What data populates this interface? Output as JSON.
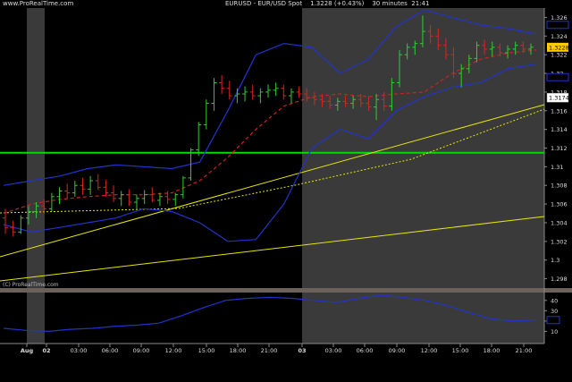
{
  "header": {
    "site": "www.ProRealTime.com",
    "instrument": "EURUSD - EUR/USD Spot",
    "price_change": "1.3228 (+0.43%)",
    "timeframe": "30 minutes",
    "clock": "21:41"
  },
  "watermark": "(C) ProRealTime.com",
  "colors": {
    "up_candle": "#33cc33",
    "down_candle": "#dd2222",
    "bollinger": "#2233cc",
    "moving_average": "#cc2222",
    "trendline": "#e6e600",
    "horizontal_line": "#00dd00",
    "today_background": "#3a3a3a",
    "price_marker": "#ffcc00"
  },
  "price_axis": {
    "ticks": [
      "1.326",
      "1.324",
      "1.322",
      "1.32",
      "1.318",
      "1.316",
      "1.314",
      "1.312",
      "1.31",
      "1.308",
      "1.306",
      "1.304",
      "1.302",
      "1.3",
      "1.298"
    ],
    "current_price_label": "1.3228",
    "trendline_label": "1.3174"
  },
  "indicator_axis": {
    "ticks": [
      "40",
      "30",
      "20",
      "10"
    ]
  },
  "time_axis": {
    "labels": [
      "Aug",
      "02",
      "03:00",
      "06:00",
      "09:00",
      "12:00",
      "15:00",
      "18:00",
      "21:00",
      "03",
      "03:00",
      "06:00",
      "09:00",
      "12:00",
      "15:00",
      "18:00",
      "21:00"
    ]
  },
  "chart_data": {
    "type": "candlestick",
    "symbol": "EURUSD",
    "timeframe": "30 minutes",
    "ylim": [
      1.297,
      1.327
    ],
    "candles": [
      [
        1.3045,
        1.3055,
        1.3028,
        1.3035
      ],
      [
        1.3035,
        1.3042,
        1.3025,
        1.303
      ],
      [
        1.303,
        1.3048,
        1.3028,
        1.3045
      ],
      [
        1.3045,
        1.3058,
        1.3038,
        1.3052
      ],
      [
        1.3052,
        1.3062,
        1.3045,
        1.3058
      ],
      [
        1.3058,
        1.3065,
        1.305,
        1.3055
      ],
      [
        1.3055,
        1.3072,
        1.3052,
        1.3068
      ],
      [
        1.3068,
        1.3078,
        1.306,
        1.3074
      ],
      [
        1.3074,
        1.3082,
        1.3066,
        1.3072
      ],
      [
        1.3072,
        1.3085,
        1.3068,
        1.308
      ],
      [
        1.308,
        1.3088,
        1.307,
        1.3076
      ],
      [
        1.3076,
        1.309,
        1.307,
        1.3085
      ],
      [
        1.3085,
        1.3092,
        1.3075,
        1.3078
      ],
      [
        1.3078,
        1.3086,
        1.3068,
        1.3072
      ],
      [
        1.3072,
        1.308,
        1.3062,
        1.3066
      ],
      [
        1.3066,
        1.3074,
        1.3058,
        1.307
      ],
      [
        1.307,
        1.3076,
        1.3058,
        1.3062
      ],
      [
        1.3062,
        1.307,
        1.3055,
        1.3066
      ],
      [
        1.3066,
        1.3075,
        1.306,
        1.307
      ],
      [
        1.307,
        1.3078,
        1.3062,
        1.3064
      ],
      [
        1.3064,
        1.3072,
        1.3058,
        1.3068
      ],
      [
        1.3068,
        1.3074,
        1.306,
        1.3065
      ],
      [
        1.3065,
        1.3072,
        1.3058,
        1.307
      ],
      [
        1.307,
        1.309,
        1.3066,
        1.3088
      ],
      [
        1.3088,
        1.312,
        1.3085,
        1.3118
      ],
      [
        1.3118,
        1.3148,
        1.3112,
        1.3145
      ],
      [
        1.3145,
        1.3172,
        1.314,
        1.3168
      ],
      [
        1.3168,
        1.3195,
        1.316,
        1.319
      ],
      [
        1.319,
        1.3198,
        1.3178,
        1.3184
      ],
      [
        1.3184,
        1.3192,
        1.3172,
        1.3176
      ],
      [
        1.3176,
        1.3184,
        1.3168,
        1.3178
      ],
      [
        1.3178,
        1.3186,
        1.317,
        1.318
      ],
      [
        1.318,
        1.3188,
        1.3172,
        1.3176
      ],
      [
        1.3176,
        1.3184,
        1.3168,
        1.318
      ],
      [
        1.318,
        1.3188,
        1.3174,
        1.3182
      ],
      [
        1.3182,
        1.319,
        1.3176,
        1.3184
      ],
      [
        1.3184,
        1.3188,
        1.3172,
        1.3176
      ],
      [
        1.3176,
        1.3184,
        1.3168,
        1.318
      ],
      [
        1.318,
        1.3186,
        1.3174,
        1.3178
      ],
      [
        1.3178,
        1.3184,
        1.317,
        1.3174
      ],
      [
        1.3174,
        1.318,
        1.3166,
        1.3172
      ],
      [
        1.3172,
        1.3178,
        1.3164,
        1.317
      ],
      [
        1.317,
        1.3176,
        1.3162,
        1.3166
      ],
      [
        1.3166,
        1.3174,
        1.316,
        1.317
      ],
      [
        1.317,
        1.3176,
        1.3164,
        1.3168
      ],
      [
        1.3168,
        1.3176,
        1.3162,
        1.3172
      ],
      [
        1.3172,
        1.3178,
        1.3164,
        1.3168
      ],
      [
        1.3168,
        1.3176,
        1.316,
        1.3164
      ],
      [
        1.3164,
        1.3178,
        1.315,
        1.3172
      ],
      [
        1.3172,
        1.318,
        1.316,
        1.3165
      ],
      [
        1.3165,
        1.3195,
        1.316,
        1.319
      ],
      [
        1.319,
        1.3225,
        1.3185,
        1.322
      ],
      [
        1.322,
        1.3232,
        1.3215,
        1.3228
      ],
      [
        1.3228,
        1.3235,
        1.322,
        1.3232
      ],
      [
        1.3232,
        1.3262,
        1.3228,
        1.3245
      ],
      [
        1.3245,
        1.3252,
        1.3232,
        1.324
      ],
      [
        1.324,
        1.3248,
        1.3225,
        1.323
      ],
      [
        1.323,
        1.3238,
        1.3215,
        1.322
      ],
      [
        1.322,
        1.3228,
        1.3195,
        1.32
      ],
      [
        1.32,
        1.321,
        1.3185,
        1.3205
      ],
      [
        1.3205,
        1.322,
        1.32,
        1.3216
      ],
      [
        1.3216,
        1.3234,
        1.3212,
        1.323
      ],
      [
        1.323,
        1.3236,
        1.322,
        1.3226
      ],
      [
        1.3226,
        1.3234,
        1.3218,
        1.3228
      ],
      [
        1.3228,
        1.3232,
        1.3218,
        1.3222
      ],
      [
        1.3222,
        1.323,
        1.3216,
        1.3226
      ],
      [
        1.3226,
        1.3234,
        1.322,
        1.323
      ],
      [
        1.323,
        1.3234,
        1.3222,
        1.3226
      ],
      [
        1.3226,
        1.3232,
        1.322,
        1.3228
      ]
    ],
    "bollinger_upper": [
      1.308,
      1.3085,
      1.309,
      1.3098,
      1.3102,
      1.31,
      1.3098,
      1.3105,
      1.316,
      1.322,
      1.3232,
      1.3228,
      1.32,
      1.3215,
      1.325,
      1.3268,
      1.326,
      1.3252,
      1.3248,
      1.3242
    ],
    "bollinger_lower": [
      1.3038,
      1.303,
      1.3035,
      1.304,
      1.3045,
      1.3055,
      1.3052,
      1.304,
      1.302,
      1.3022,
      1.306,
      1.312,
      1.314,
      1.313,
      1.316,
      1.3175,
      1.3185,
      1.319,
      1.3205,
      1.321
    ],
    "moving_average": [
      1.305,
      1.306,
      1.3065,
      1.3068,
      1.307,
      1.307,
      1.3072,
      1.3085,
      1.311,
      1.314,
      1.3165,
      1.3175,
      1.3178,
      1.3175,
      1.3178,
      1.318,
      1.32,
      1.3215,
      1.3222,
      1.3225
    ],
    "horizontal_line": 1.3115,
    "indicator": {
      "ylim": [
        0,
        45
      ],
      "values": [
        13,
        11,
        10,
        12,
        13,
        15,
        16,
        18,
        25,
        33,
        40,
        42,
        43,
        42,
        40,
        38,
        42,
        45,
        43,
        40,
        35,
        28,
        22,
        20,
        21
      ]
    }
  }
}
